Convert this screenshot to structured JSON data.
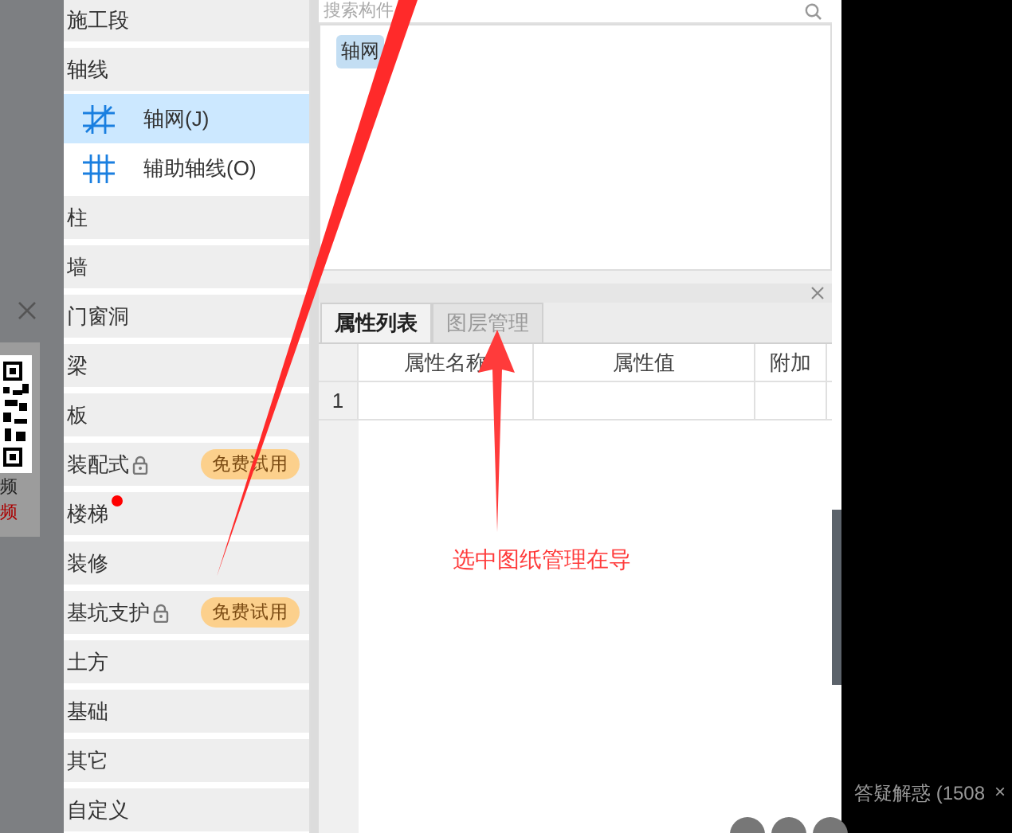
{
  "side_overlay": {
    "texts": [
      "频",
      "频"
    ]
  },
  "sidebar": {
    "items": [
      {
        "label": "施工段"
      },
      {
        "label": "轴线",
        "children": [
          {
            "label": "轴网(J)",
            "kind": "diagonal-grid",
            "selected": true
          },
          {
            "label": "辅助轴线(O)",
            "kind": "grid",
            "selected": false
          }
        ]
      },
      {
        "label": "柱"
      },
      {
        "label": "墙"
      },
      {
        "label": "门窗洞"
      },
      {
        "label": "梁"
      },
      {
        "label": "板"
      },
      {
        "label": "装配式",
        "locked": true,
        "badge": "免费试用"
      },
      {
        "label": "楼梯",
        "new_dot": true
      },
      {
        "label": "装修"
      },
      {
        "label": "基坑支护",
        "locked": true,
        "badge": "免费试用"
      },
      {
        "label": "土方"
      },
      {
        "label": "基础"
      },
      {
        "label": "其它"
      },
      {
        "label": "自定义"
      }
    ]
  },
  "component_panel": {
    "search": {
      "placeholder": "搜索构件"
    },
    "items": [
      {
        "label": "轴网",
        "selected": true
      }
    ]
  },
  "properties": {
    "tabs": [
      {
        "label": "属性列表",
        "selected": true
      },
      {
        "label": "图层管理",
        "selected": false
      }
    ],
    "columns": [
      "属性名称",
      "属性值",
      "附加"
    ],
    "rows": [
      {
        "number": "1"
      }
    ]
  },
  "annotation": {
    "text": "选中图纸管理在导"
  },
  "notification": {
    "text": "答疑解惑 (1508",
    "close": "×"
  }
}
